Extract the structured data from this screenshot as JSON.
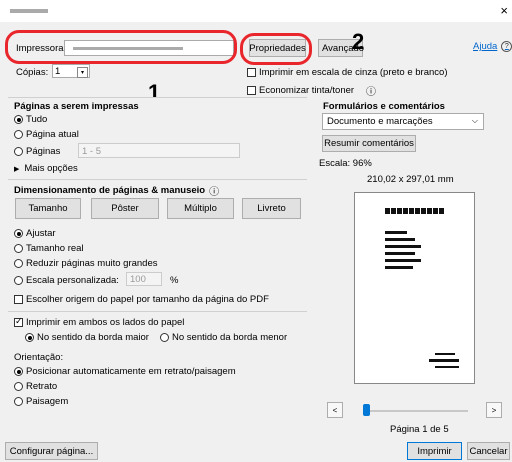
{
  "window": {
    "title_redacted": "",
    "close_glyph": "×"
  },
  "printer": {
    "label": "Impressora:",
    "properties": "Propriedades",
    "advanced": "Avançado",
    "help": "Ajuda",
    "help_icon": "?"
  },
  "copies": {
    "label": "Cópias:",
    "value": "1"
  },
  "grayscale": {
    "label": "Imprimir em escala de cinza (preto e branco)"
  },
  "toner": {
    "label": "Economizar tinta/toner",
    "info": "ⓘ"
  },
  "callouts": {
    "one": "1",
    "two": "2"
  },
  "pages": {
    "title": "Páginas a serem impressas",
    "all": "Tudo",
    "current": "Página atual",
    "pages": "Páginas",
    "range_value": "1 - 5",
    "more": "Mais opções"
  },
  "sizing": {
    "title": "Dimensionamento de páginas & manuseio",
    "info": "ⓘ",
    "tabs": [
      "Tamanho",
      "Pôster",
      "Múltiplo",
      "Livreto"
    ],
    "fit": "Ajustar",
    "actual": "Tamanho real",
    "shrink": "Reduzir páginas muito grandes",
    "custom": "Escala personalizada:",
    "custom_value": "100",
    "percent": "%",
    "source": "Escolher origem do papel por tamanho da página do PDF"
  },
  "duplex": {
    "label": "Imprimir em ambos os lados do papel",
    "long": "No sentido da borda maior",
    "short": "No sentido da borda menor"
  },
  "orientation": {
    "label": "Orientação:",
    "auto": "Posicionar automaticamente em retrato/paisagem",
    "portrait": "Retrato",
    "landscape": "Paisagem"
  },
  "forms": {
    "title": "Formulários e comentários",
    "value": "Documento e marcações",
    "summarize": "Resumir comentários"
  },
  "preview": {
    "scale": "Escala: 96%",
    "size": "210,02 x 297,01 mm",
    "page_label": "Página 1 de 5"
  },
  "footer": {
    "setup": "Configurar página...",
    "print": "Imprimir",
    "cancel": "Cancelar"
  }
}
